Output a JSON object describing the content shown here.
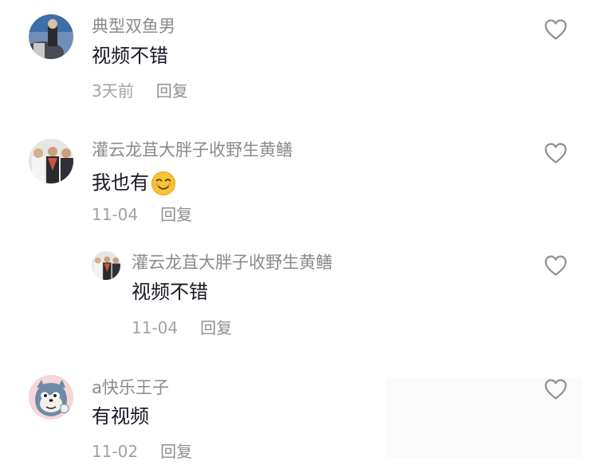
{
  "comments": [
    {
      "username": "典型双鱼男",
      "text": "视频不错",
      "time": "3天前",
      "reply_label": "回复",
      "avatar_icon": "avatar-sky-figure"
    },
    {
      "username": "灌云龙苴大胖子收野生黄鳝",
      "text": "我也有",
      "emoji_icon": "smiling-emoji-icon",
      "time": "11-04",
      "reply_label": "回复",
      "avatar_icon": "avatar-group-photo",
      "replies": [
        {
          "username": "灌云龙苴大胖子收野生黄鳝",
          "text": "视频不错",
          "time": "11-04",
          "reply_label": "回复",
          "avatar_icon": "avatar-group-photo"
        }
      ]
    },
    {
      "username": "a快乐王子",
      "text": "有视频",
      "time": "11-02",
      "reply_label": "回复",
      "avatar_icon": "avatar-cartoon-cat"
    }
  ],
  "like_icon": "heart-outline-icon",
  "colors": {
    "username": "#8a8a8a",
    "text": "#161823",
    "meta": "#a2a2a2",
    "icon": "#8f8f8f"
  }
}
